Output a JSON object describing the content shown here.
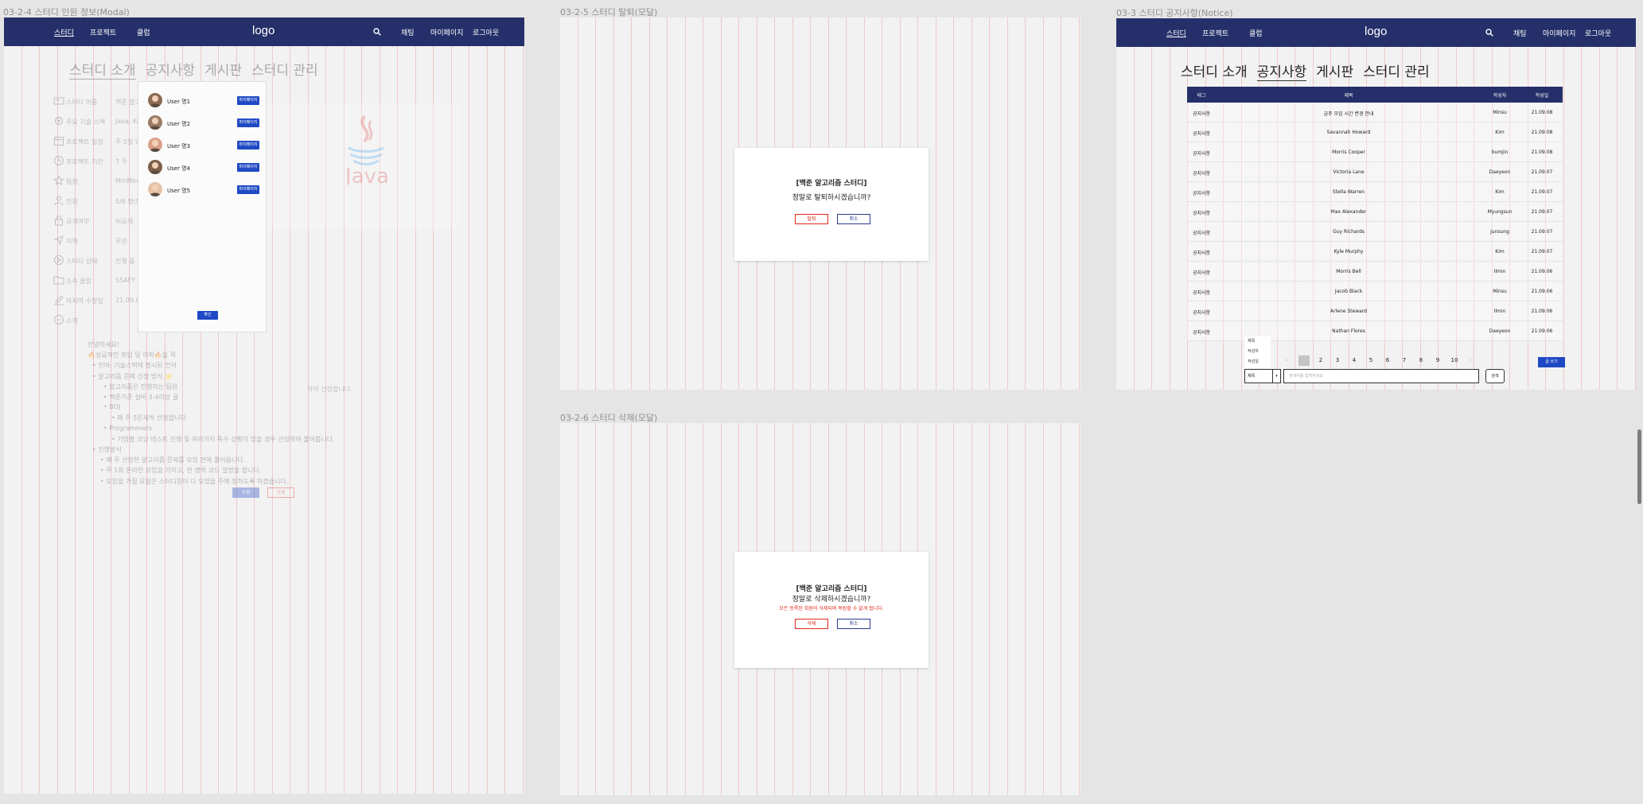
{
  "frames": {
    "member_modal": {
      "title": "03-2-4 스터디 인원 정보(Modal)"
    },
    "leave_modal": {
      "title": "03-2-5 스터디 탈퇴(모달)"
    },
    "notice": {
      "title": "03-3 스터디 공지사항(Notice)"
    },
    "delete_modal": {
      "title": "03-2-6 스터디 삭제(모달)"
    }
  },
  "nav": {
    "study": "스터디",
    "project": "프로젝트",
    "club": "클럽",
    "logo": "logo",
    "chat": "채팅",
    "mypage": "마이페이지",
    "logout": "로그아웃"
  },
  "tabs": [
    "스터디 소개",
    "공지사항",
    "게시판",
    "스터디 관리"
  ],
  "study_info": {
    "rows": [
      {
        "icon": "card-icon",
        "label": "스터디 이름",
        "value": "백준 알고리"
      },
      {
        "icon": "gear-icon",
        "label": "주요 기술 스택",
        "value": "Java, Kot"
      },
      {
        "icon": "calendar-icon",
        "label": "프로젝트 일정",
        "value": "주 5일 9:4"
      },
      {
        "icon": "clock-icon",
        "label": "프로젝트 기간",
        "value": "7 주"
      },
      {
        "icon": "star-icon",
        "label": "팀장",
        "value": "MinMin"
      },
      {
        "icon": "person-icon",
        "label": "인원",
        "value": "5/6 명(M"
      },
      {
        "icon": "lock-icon",
        "label": "공개여부",
        "value": "비공개"
      },
      {
        "icon": "location-icon",
        "label": "지역",
        "value": "무관"
      },
      {
        "icon": "play-icon",
        "label": "스터디 상태",
        "value": "진행 중"
      },
      {
        "icon": "folder-icon",
        "label": "소속 클럽",
        "value": "SSAFY"
      },
      {
        "icon": "pencil-icon",
        "label": "마지막 수정일",
        "value": "21.09.07"
      },
      {
        "icon": "chat-icon",
        "label": "소개",
        "value": ""
      }
    ],
    "intro": [
      "안녕하세요!",
      "🔥성공적인 취업 및 이직🔥을 목",
      "• 언어: 기술스택에 명시된 언어",
      "• 알고리즘 문제 선정 방식 🌟",
      "• 알고리즘은 진행하는 팀원",
      "• 백준기준 실버 3-4이상 골",
      "• BOJ",
      "• 매 주 5문제씩 선정합니다.",
      "• Programmers",
      "• 기업별 코딩 테스트 진행 및 여러가지 특수 상황이 있을 경우 선정하여 풀어봅니다.",
      "• 진행방식",
      "• 매 주 선정한 알고리즘 문제를 모임 전에 풀어옵니다.",
      "• 주 1회 온라인 모임을 가지고, 한 명씩 코드 설명을 합니다.",
      "• 모임을 가질 요일은 스터디원이 다 모였을 주에 정하도록 하겠습니다."
    ],
    "intro_cut": "하여 선정합니다.",
    "edit_label": "수정",
    "delete_label": "삭제"
  },
  "member_modal": {
    "members": [
      {
        "name": "User 명1",
        "button": "마이페이지"
      },
      {
        "name": "User 명2",
        "button": "마이페이지"
      },
      {
        "name": "User 명3",
        "button": "마이페이지"
      },
      {
        "name": "User 명4",
        "button": "마이페이지"
      },
      {
        "name": "User 명5",
        "button": "마이페이지"
      }
    ],
    "confirm": "확인"
  },
  "leave_modal": {
    "title": "[백준 알고리즘 스터디]",
    "message": "정말로 탈퇴하시겠습니까?",
    "confirm": "탈퇴",
    "cancel": "취소"
  },
  "delete_modal": {
    "title": "[백준 알고리즘 스터디]",
    "message": "정말로 삭제하시겠습니까?",
    "warning": "모든 등록된 회원의 삭제되며 복원할 수 없게 됩니다.",
    "confirm": "삭제",
    "cancel": "취소"
  },
  "notice": {
    "headers": [
      "태그",
      "제목",
      "작성자",
      "작성일"
    ],
    "rows": [
      [
        "공지사항",
        "금주 모임 시간 변경 안내",
        "Minsu",
        "21.09.08"
      ],
      [
        "공지사항",
        "Savannah Howard",
        "Kim",
        "21.09.08"
      ],
      [
        "공지사항",
        "Morris Cooper",
        "bumjin",
        "21.09.08"
      ],
      [
        "공지사항",
        "Victoria Lane",
        "Daeyeon",
        "21.09.07"
      ],
      [
        "공지사항",
        "Stella Warren",
        "Kim",
        "21.09.07"
      ],
      [
        "공지사항",
        "Max Alexander",
        "Myungsun",
        "21.09.07"
      ],
      [
        "공지사항",
        "Guy Richards",
        "junsung",
        "21.09.07"
      ],
      [
        "공지사항",
        "Kyle Murphy",
        "Kim",
        "21.09.07"
      ],
      [
        "공지사항",
        "Morris Bell",
        "Ilmin",
        "21.09.06"
      ],
      [
        "공지사항",
        "Jacob Black",
        "Minsu",
        "21.09.06"
      ],
      [
        "공지사항",
        "Arlene Steward",
        "Ilmin",
        "21.09.06"
      ],
      [
        "공지사항",
        "Nathan Flores",
        "Daeyeon",
        "21.09.06"
      ]
    ],
    "pages": [
      "<",
      "1",
      "2",
      "3",
      "4",
      "5",
      "6",
      "7",
      "8",
      "9",
      "10",
      ">"
    ],
    "current_page": "1",
    "write_button": "글 쓰기",
    "dropdown_options": [
      "제목",
      "작성자",
      "작성일"
    ],
    "select_value": "제목",
    "search_placeholder": "검색어를 입력하세요",
    "search_button": "검색"
  },
  "colors": {
    "navbar": "#25306a",
    "primary": "#1f49c4",
    "danger": "#e0291e",
    "grid_line": "#ee9696"
  }
}
